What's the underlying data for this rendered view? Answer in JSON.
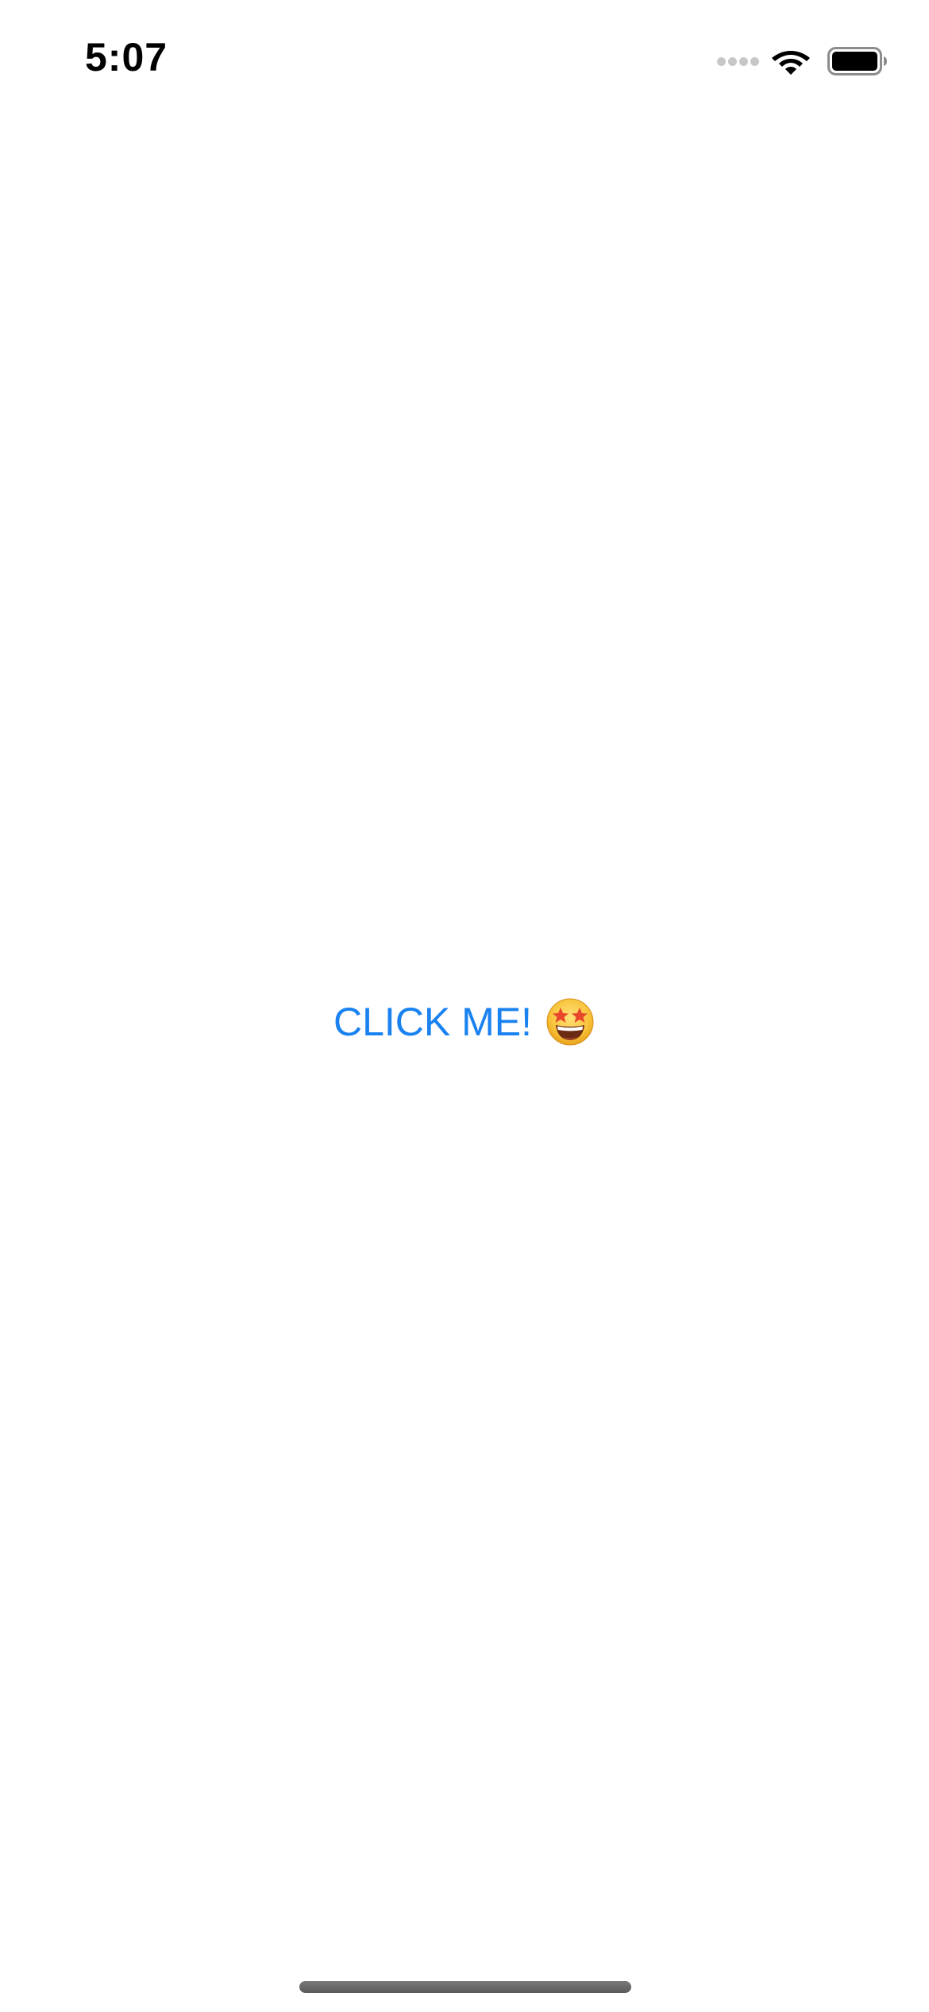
{
  "status_bar": {
    "time": "5:07",
    "icons": [
      "cellular-signal-icon",
      "wifi-icon",
      "battery-icon"
    ],
    "battery_level": 1.0
  },
  "main": {
    "button_label": "CLICK ME!",
    "button_emoji": "star-struck-emoji",
    "accent_color": "#1a82f0"
  }
}
